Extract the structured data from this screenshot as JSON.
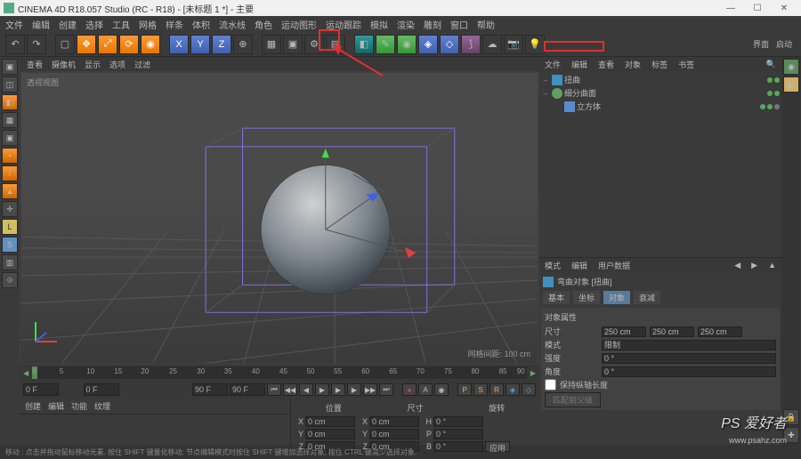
{
  "title": "CINEMA 4D R18.057 Studio (RC - R18) - [未标题 1 *] - 主要",
  "menu": [
    "文件",
    "编辑",
    "创建",
    "选择",
    "工具",
    "网格",
    "样条",
    "体积",
    "流水线",
    "角色",
    "运动图形",
    "运动跟踪",
    "模拟",
    "渲染",
    "雕刻",
    "窗口",
    "帮助"
  ],
  "vptabs": [
    "查看",
    "摄像机",
    "显示",
    "选项",
    "过滤"
  ],
  "vplabel": "透视视图",
  "vpinfo": "网格间距: 100 cm",
  "timeline": {
    "start": 0,
    "end": 90,
    "ticks": [
      0,
      5,
      10,
      15,
      20,
      25,
      30,
      35,
      40,
      45,
      50,
      55,
      60,
      65,
      70,
      75,
      80,
      85,
      90
    ],
    "cur": "0 F",
    "endlabel": "90 F",
    "startlabel": "0 F"
  },
  "coords": {
    "headers": [
      "位置",
      "尺寸",
      "旋转"
    ],
    "X": {
      "pos": "0 cm",
      "size": "0 cm",
      "rot": "0 °"
    },
    "Y": {
      "pos": "0 cm",
      "size": "0 cm",
      "rot": "0 °"
    },
    "Z": {
      "pos": "0 cm",
      "size": "0 cm",
      "rot": "0 °"
    },
    "apply": "应用"
  },
  "bottomtabs": [
    "创建",
    "编辑",
    "功能",
    "纹理"
  ],
  "righttop": [
    "界面",
    "启动"
  ],
  "objtabs": [
    "文件",
    "编辑",
    "查看",
    "对象",
    "标签",
    "书签"
  ],
  "objects": [
    {
      "name": "扭曲",
      "icon": "bend",
      "depth": 0,
      "expand": "–"
    },
    {
      "name": "细分曲面",
      "icon": "sds",
      "depth": 0,
      "expand": "–"
    },
    {
      "name": "立方体",
      "icon": "cube",
      "depth": 1,
      "expand": ""
    }
  ],
  "attrtabs": [
    "模式",
    "编辑",
    "用户数据"
  ],
  "attrtitle": "弯曲对象 [扭曲]",
  "subtabs": [
    "基本",
    "坐标",
    "对象",
    "衰减"
  ],
  "attrgroup_title": "对象属性",
  "attrs": {
    "size_label": "尺寸",
    "size_vals": [
      "250 cm",
      "250 cm",
      "250 cm"
    ],
    "mode_label": "模式",
    "mode_val": "限制",
    "strength_label": "强度",
    "strength_val": "0 °",
    "angle_label": "角度",
    "angle_val": "0 °",
    "keep_label": "保持纵轴长度"
  },
  "fit_button": "匹配到父级",
  "statusbar": "移动 : 点击并拖动鼠标移动元素. 按住 SHIFT 键量化移动; 节点编辑模式时按住 SHIFT 键增加选择对象; 按住 CTRL 键减少选择对象."
}
